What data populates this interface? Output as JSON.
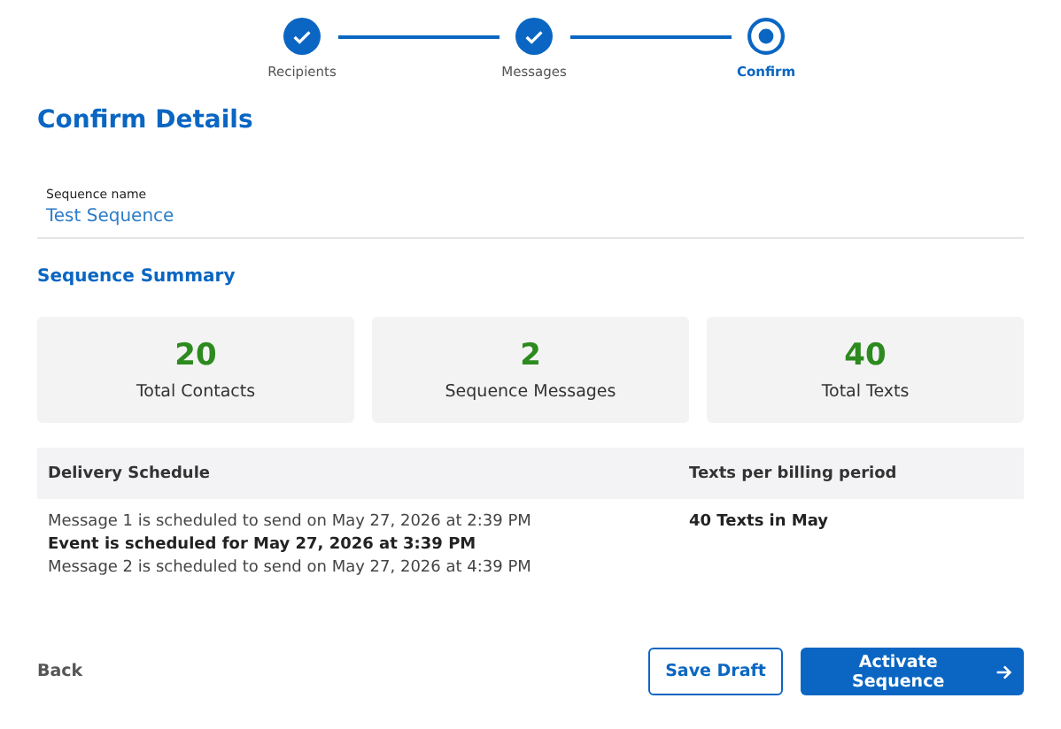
{
  "steps": [
    {
      "label": "Recipients",
      "completed": true,
      "selected": false
    },
    {
      "label": "Messages",
      "completed": true,
      "selected": false
    },
    {
      "label": "Confirm",
      "completed": false,
      "selected": true
    }
  ],
  "title": "Confirm Details",
  "sequence_name": {
    "label": "Sequence name",
    "value": "Test Sequence"
  },
  "summary": {
    "heading": "Sequence Summary",
    "stats": [
      {
        "value": "20",
        "label": "Total Contacts"
      },
      {
        "value": "2",
        "label": "Sequence Messages"
      },
      {
        "value": "40",
        "label": "Total Texts"
      }
    ]
  },
  "table": {
    "columns": [
      "Delivery Schedule",
      "Texts per billing period"
    ],
    "schedule": [
      {
        "kind": "message",
        "text": "Message 1 is scheduled to send on May 27, 2026 at 2:39 PM"
      },
      {
        "kind": "event",
        "text": "Event is scheduled for May 27, 2026 at 3:39 PM"
      },
      {
        "kind": "message",
        "text": "Message 2 is scheduled to send on May 27, 2026 at 4:39 PM"
      }
    ],
    "texts_per_period": "40 Texts in May"
  },
  "buttons": {
    "back": "Back",
    "save": "Save Draft",
    "activate": "Activate Sequence"
  }
}
